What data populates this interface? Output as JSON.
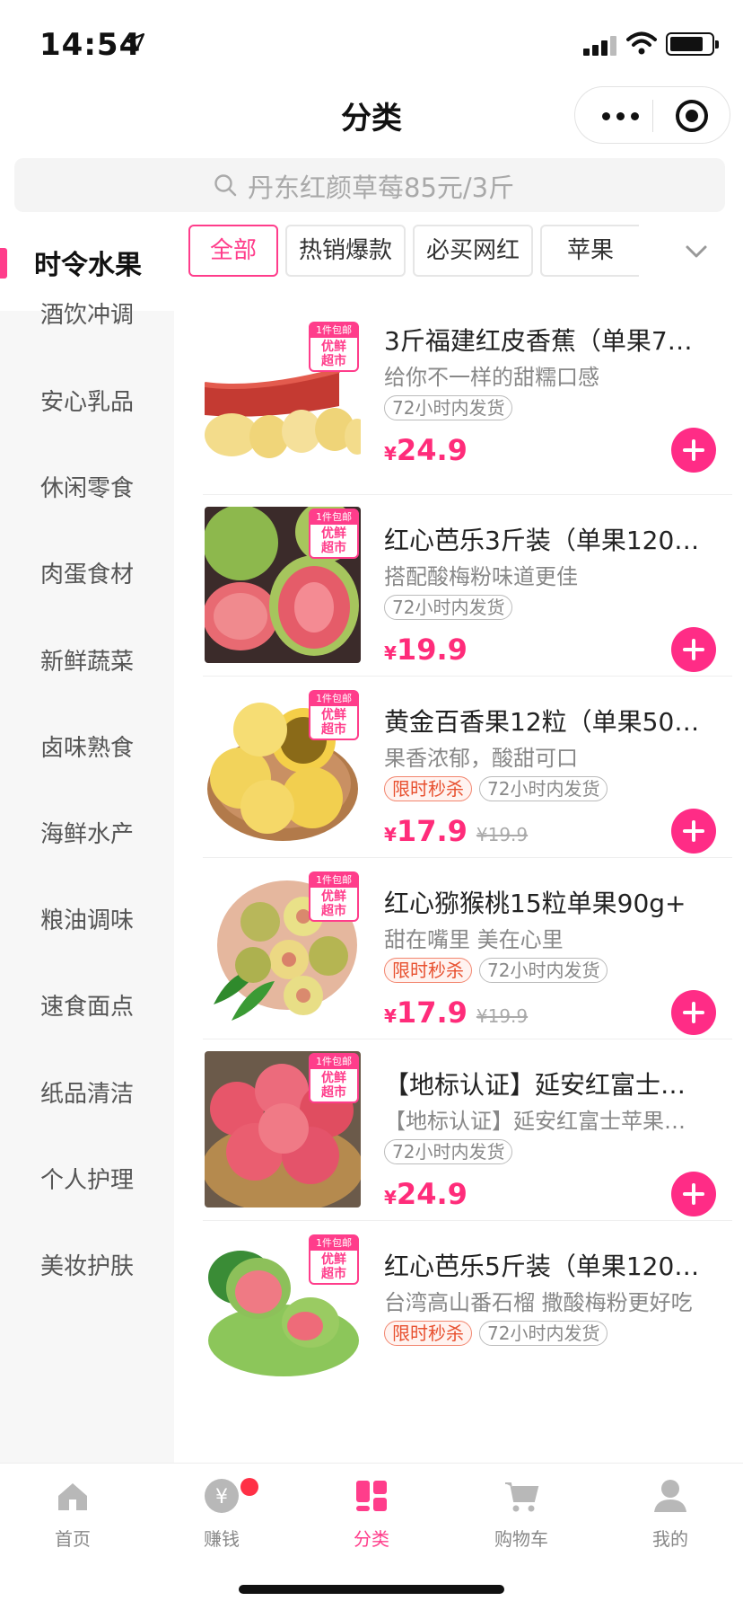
{
  "status": {
    "time": "14:54"
  },
  "nav": {
    "title": "分类"
  },
  "search": {
    "placeholder": "丹东红颜草莓85元/3斤"
  },
  "sidebar": {
    "active": "时令水果",
    "items": [
      "酒饮冲调",
      "安心乳品",
      "休闲零食",
      "肉蛋食材",
      "新鲜蔬菜",
      "卤味熟食",
      "海鲜水产",
      "粮油调味",
      "速食面点",
      "纸品清洁",
      "个人护理",
      "美妆护肤"
    ]
  },
  "tags": [
    "全部",
    "热销爆款",
    "必买网红",
    "苹果"
  ],
  "badge": {
    "line1": "1件包邮",
    "line2": "优鲜",
    "line3": "超市"
  },
  "products": [
    {
      "title": "3斤福建红皮香蕉（单果7…",
      "subtitle": "给你不一样的甜糯口感",
      "labels": [
        "72小时内发货"
      ],
      "flash": "",
      "currency": "¥",
      "price": "24.9",
      "old_price": ""
    },
    {
      "title": "红心芭乐3斤装（单果120…",
      "subtitle": "搭配酸梅粉味道更佳",
      "labels": [
        "72小时内发货"
      ],
      "flash": "",
      "currency": "¥",
      "price": "19.9",
      "old_price": ""
    },
    {
      "title": "黄金百香果12粒（单果50…",
      "subtitle": "果香浓郁，酸甜可口",
      "labels": [
        "72小时内发货"
      ],
      "flash": "限时秒杀",
      "currency": "¥",
      "price": "17.9",
      "old_price": "¥19.9"
    },
    {
      "title": "红心猕猴桃15粒单果90g+",
      "subtitle": "甜在嘴里 美在心里",
      "labels": [
        "72小时内发货"
      ],
      "flash": "限时秒杀",
      "currency": "¥",
      "price": "17.9",
      "old_price": "¥19.9"
    },
    {
      "title": "【地标认证】延安红富士…",
      "subtitle": "【地标认证】延安红富士苹果…",
      "labels": [
        "72小时内发货"
      ],
      "flash": "",
      "currency": "¥",
      "price": "24.9",
      "old_price": ""
    },
    {
      "title": "红心芭乐5斤装（单果120…",
      "subtitle": "台湾高山番石榴 撒酸梅粉更好吃",
      "labels": [
        "72小时内发货"
      ],
      "flash": "限时秒杀",
      "currency": "¥",
      "price": "",
      "old_price": ""
    }
  ],
  "tabbar": {
    "items": [
      {
        "label": "首页",
        "icon": "home-icon"
      },
      {
        "label": "赚钱",
        "icon": "yen-coin-icon"
      },
      {
        "label": "分类",
        "icon": "category-icon"
      },
      {
        "label": "购物车",
        "icon": "cart-icon"
      },
      {
        "label": "我的",
        "icon": "user-icon"
      }
    ],
    "active_index": 2
  },
  "colors": {
    "accent": "#ff3d8b",
    "price": "#ff2c7a",
    "flash": "#e8502f"
  }
}
